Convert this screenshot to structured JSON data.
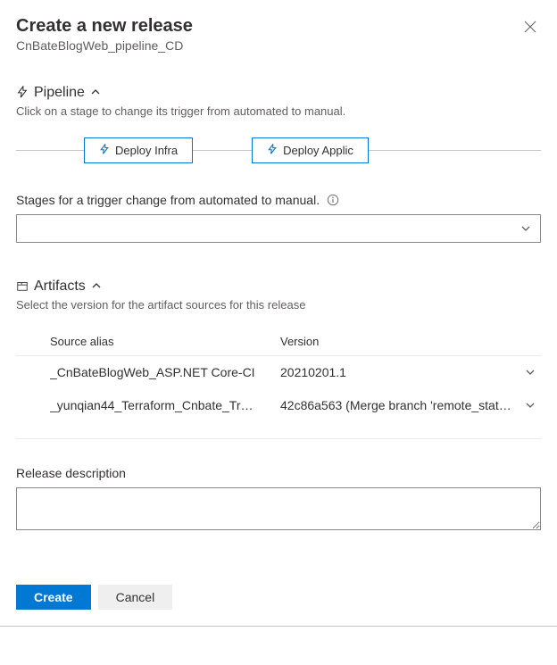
{
  "header": {
    "title": "Create a new release",
    "subtitle": "CnBateBlogWeb_pipeline_CD"
  },
  "pipeline": {
    "section_label": "Pipeline",
    "instruction": "Click on a stage to change its trigger from automated to manual.",
    "stages": [
      {
        "label": "Deploy Infra"
      },
      {
        "label": "Deploy Applic"
      }
    ],
    "trigger_label": "Stages for a trigger change from automated to manual.",
    "trigger_value": ""
  },
  "artifacts": {
    "section_label": "Artifacts",
    "instruction": "Select the version for the artifact sources for this release",
    "columns": {
      "alias": "Source alias",
      "version": "Version"
    },
    "rows": [
      {
        "alias": "_CnBateBlogWeb_ASP.NET Core-CI",
        "version": "20210201.1"
      },
      {
        "alias": "_yunqian44_Terraform_Cnbate_Tr…",
        "version": "42c86a563 (Merge branch 'remote_stats' …"
      }
    ]
  },
  "description": {
    "label": "Release description",
    "value": ""
  },
  "footer": {
    "create": "Create",
    "cancel": "Cancel"
  }
}
